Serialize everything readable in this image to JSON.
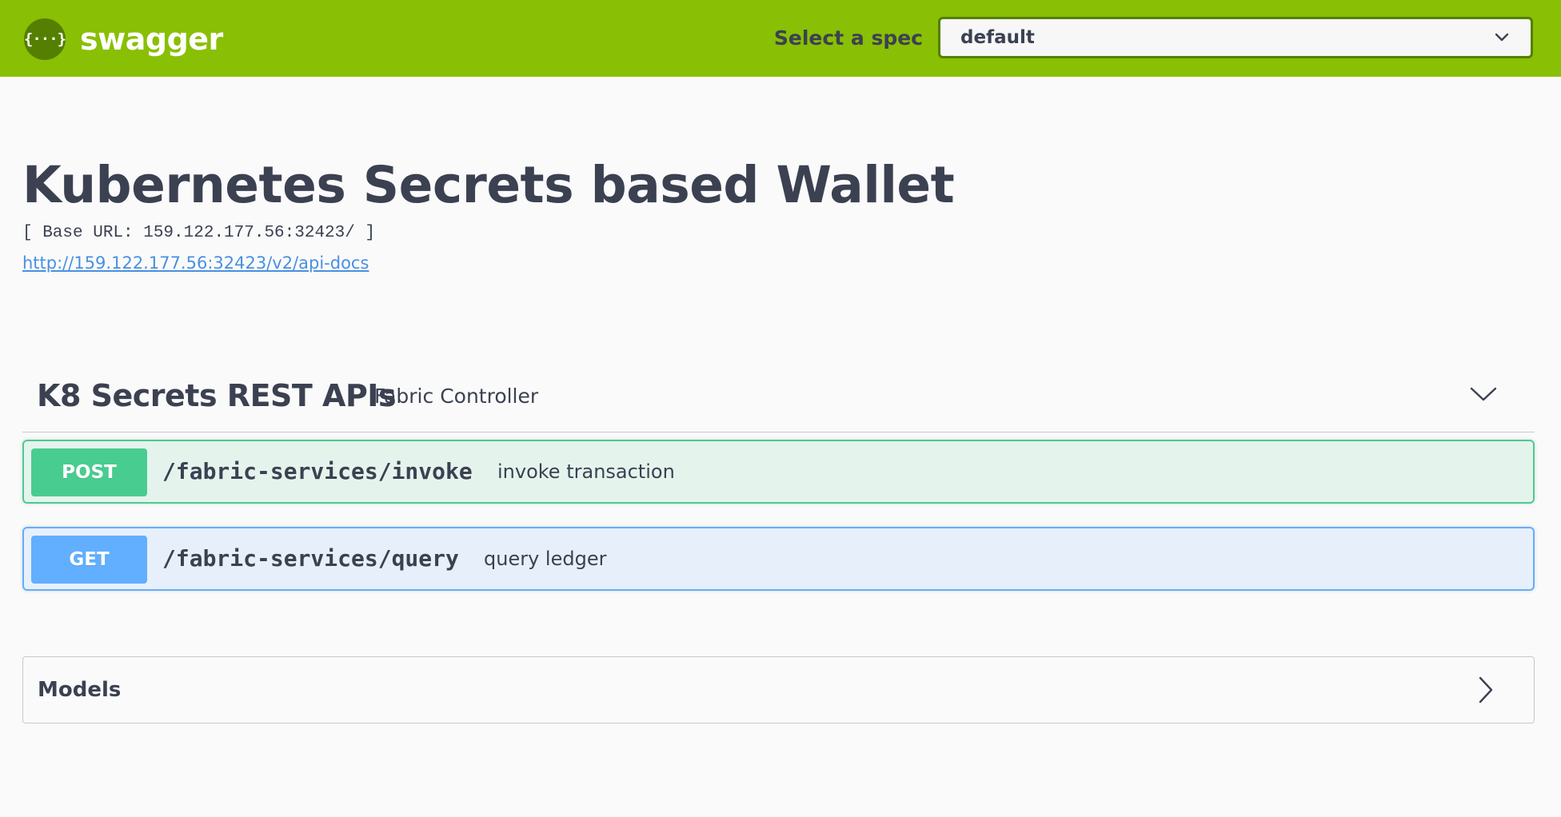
{
  "topbar": {
    "logo_glyph": "{···}",
    "logo_text": "swagger",
    "spec_label": "Select a spec",
    "spec_selected": "default",
    "icons": {
      "logo": "swagger-logo-icon",
      "dropdown": "chevron-down-icon"
    },
    "colors": {
      "bar": "#89bf04",
      "logo_badge": "#547f00"
    }
  },
  "info": {
    "title": "Kubernetes Secrets based Wallet",
    "base_url": "[ Base URL: 159.122.177.56:32423/ ]",
    "api_docs_link": "http://159.122.177.56:32423/v2/api-docs"
  },
  "tag": {
    "name": "K8 Secrets REST APIs",
    "description": "Fabric Controller",
    "toggle_icon": "chevron-down-icon",
    "operations": [
      {
        "method": "POST",
        "path": "/fabric-services/invoke",
        "summary": "invoke transaction",
        "color": "#49cc90"
      },
      {
        "method": "GET",
        "path": "/fabric-services/query",
        "summary": "query ledger",
        "color": "#61affe"
      }
    ]
  },
  "models": {
    "title": "Models",
    "toggle_icon": "chevron-right-icon"
  }
}
